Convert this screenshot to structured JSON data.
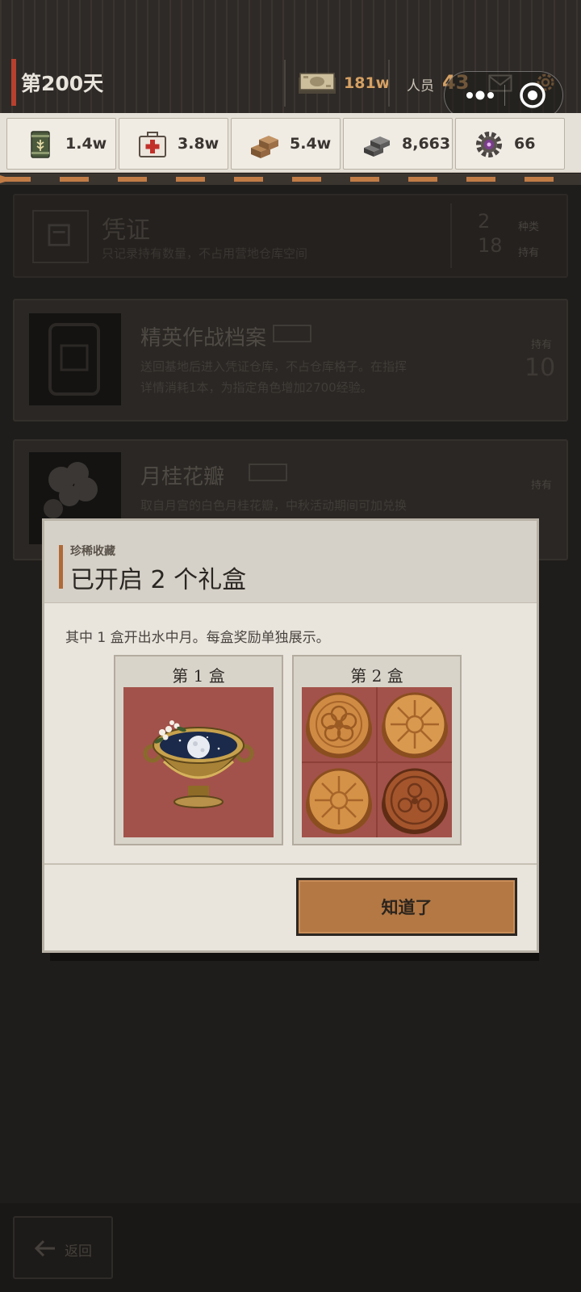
{
  "header": {
    "day_title": "第200天",
    "money_value": "181w",
    "people_label": "人员",
    "people_value": "43",
    "icons": [
      "money-icon",
      "mail-icon",
      "settings-icon",
      "more-icon",
      "close-icon"
    ]
  },
  "resources": [
    {
      "icon": "food-can-icon",
      "value": "1.4w"
    },
    {
      "icon": "medkit-icon",
      "value": "3.8w"
    },
    {
      "icon": "wood-icon",
      "value": "5.4w"
    },
    {
      "icon": "steel-icon",
      "value": "8,663"
    },
    {
      "icon": "gear-chip-icon",
      "value": "66"
    }
  ],
  "background_list": {
    "header": {
      "title": "凭证",
      "desc": "只记录持有数量，不占用营地仓库空间",
      "count_1": "2",
      "count_1_label": "种类",
      "count_2": "18",
      "count_2_label": "持有"
    },
    "items": [
      {
        "title": "精英作战档案",
        "desc_line1": "送回基地后进入凭证仓库，不占仓库格子。在指挥",
        "desc_line2": "详情消耗1本，为指定角色增加2700经验。",
        "qty_label": "持有",
        "qty": "10"
      },
      {
        "title": "月桂花瓣",
        "desc_line1": "取自月宫的白色月桂花瓣，中秋活动期间可加兑换",
        "qty_label": "持有"
      }
    ]
  },
  "modal": {
    "kicker": "珍稀收藏",
    "title": "已开启 2 个礼盒",
    "description": "其中 1 盒开出水中月。每盒奖励单独展示。",
    "boxes": [
      {
        "label": "第 1 盒",
        "reward": "水中月"
      },
      {
        "label": "第 2 盒",
        "reward": "月饼"
      }
    ],
    "confirm_label": "知道了"
  },
  "bottom": {
    "back_label": "返回"
  },
  "colors": {
    "accent_red": "#b8402e",
    "gold_text": "#d6a163",
    "button": "#b37844",
    "reward_bg": "#a2524a"
  }
}
